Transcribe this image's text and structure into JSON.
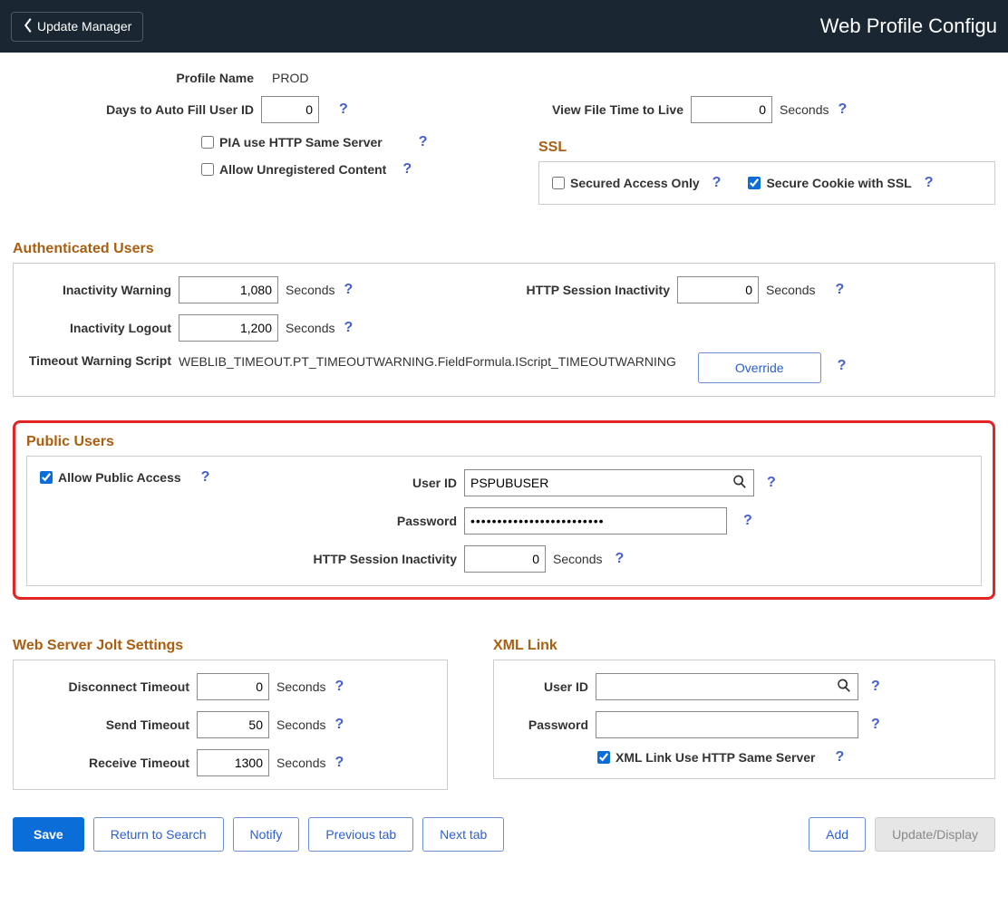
{
  "header": {
    "back_label": "Update Manager",
    "title": "Web Profile Configu"
  },
  "profile": {
    "name_label": "Profile Name",
    "name_value": "PROD",
    "days_autofill_label": "Days to Auto Fill User ID",
    "days_autofill_value": "0",
    "pia_same_server_label": "PIA use HTTP Same Server",
    "allow_unreg_label": "Allow Unregistered Content",
    "view_file_ttl_label": "View File Time to Live",
    "view_file_ttl_value": "0",
    "seconds_label": "Seconds"
  },
  "ssl": {
    "title": "SSL",
    "secured_access_label": "Secured Access Only",
    "secure_cookie_label": "Secure Cookie with SSL"
  },
  "auth_users": {
    "title": "Authenticated Users",
    "inactivity_warning_label": "Inactivity Warning",
    "inactivity_warning_value": "1,080",
    "inactivity_logout_label": "Inactivity Logout",
    "inactivity_logout_value": "1,200",
    "http_session_label": "HTTP Session Inactivity",
    "http_session_value": "0",
    "timeout_script_label": "Timeout Warning Script",
    "timeout_script_value": "WEBLIB_TIMEOUT.PT_TIMEOUTWARNING.FieldFormula.IScript_TIMEOUTWARNING",
    "override_label": "Override",
    "seconds_label": "Seconds"
  },
  "public_users": {
    "title": "Public Users",
    "allow_public_label": "Allow Public Access",
    "user_id_label": "User ID",
    "user_id_value": "PSPUBUSER",
    "password_label": "Password",
    "password_value": "•••••••••••••••••••••••••",
    "http_session_label": "HTTP Session Inactivity",
    "http_session_value": "0",
    "seconds_label": "Seconds"
  },
  "jolt": {
    "title": "Web Server Jolt Settings",
    "disconnect_label": "Disconnect Timeout",
    "disconnect_value": "0",
    "send_label": "Send Timeout",
    "send_value": "50",
    "receive_label": "Receive Timeout",
    "receive_value": "1300",
    "seconds_label": "Seconds"
  },
  "xml_link": {
    "title": "XML Link",
    "user_id_label": "User ID",
    "user_id_value": "",
    "password_label": "Password",
    "password_value": "",
    "same_server_label": "XML Link Use HTTP Same Server"
  },
  "footer": {
    "save": "Save",
    "return_search": "Return to Search",
    "notify": "Notify",
    "prev_tab": "Previous tab",
    "next_tab": "Next tab",
    "add": "Add",
    "update_display": "Update/Display"
  }
}
